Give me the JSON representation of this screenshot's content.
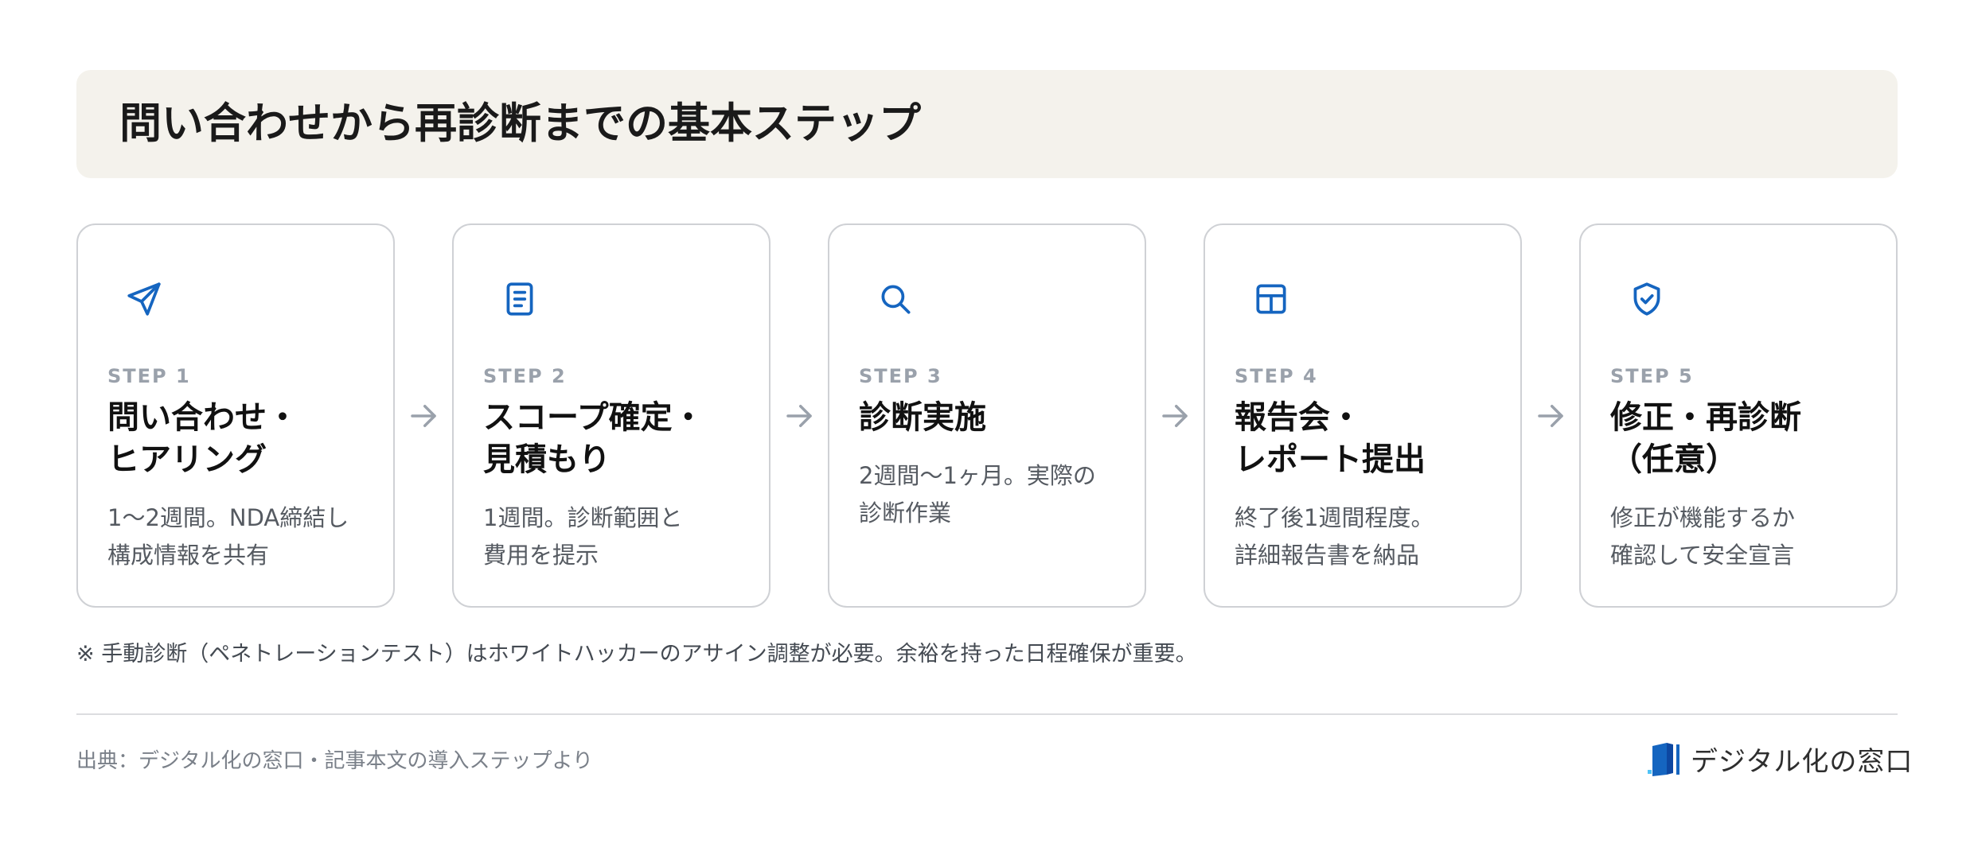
{
  "title": "問い合わせから再診断までの基本ステップ",
  "steps": [
    {
      "label": "STEP 1",
      "title": "問い合わせ・\nヒアリング",
      "desc": "1〜2週間。NDA締結し\n構成情報を共有",
      "icon": "send-icon"
    },
    {
      "label": "STEP 2",
      "title": "スコープ確定・\n見積もり",
      "desc": "1週間。診断範囲と\n費用を提示",
      "icon": "document-icon"
    },
    {
      "label": "STEP 3",
      "title": "診断実施",
      "desc": "2週間〜1ヶ月。実際の\n診断作業",
      "icon": "search-icon"
    },
    {
      "label": "STEP 4",
      "title": "報告会・\nレポート提出",
      "desc": "終了後1週間程度。\n詳細報告書を納品",
      "icon": "table-icon"
    },
    {
      "label": "STEP 5",
      "title": "修正・再診断\n（任意）",
      "desc": "修正が機能するか\n確認して安全宣言",
      "icon": "shield-check-icon"
    }
  ],
  "note": "※ 手動診断（ペネトレーションテスト）はホワイトハッカーのアサイン調整が必要。余裕を持った日程確保が重要。",
  "source": "出典：デジタル化の窓口・記事本文の導入ステップより",
  "logo": {
    "text": "デジタル化の窓口",
    "icon": "book-logo-icon"
  },
  "colors": {
    "accent": "#1565c0",
    "title_bg": "#f4f2ec",
    "card_border": "#cfd1d5",
    "step_label": "#9aa1ab",
    "arrow": "#9aa1ab"
  }
}
